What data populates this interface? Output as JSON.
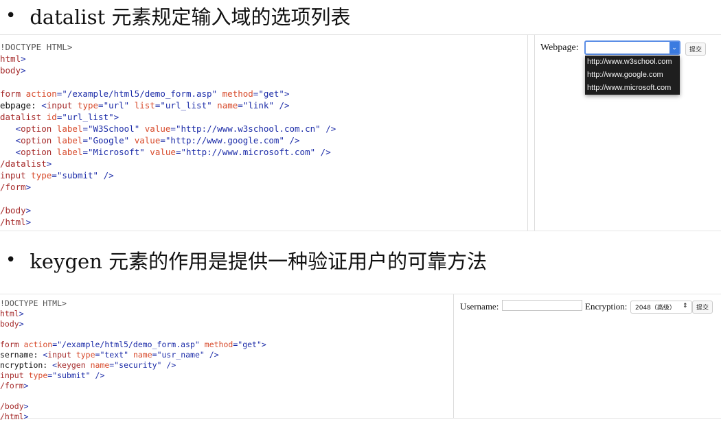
{
  "section1": {
    "bullet": "datalist 元素规定输入域的选项列表",
    "code_lines": [
      "!DOCTYPE HTML>",
      "html>",
      "body>",
      "",
      "form action=\"/example/html5/demo_form.asp\" method=\"get\">",
      "ebpage: <input type=\"url\" list=\"url_list\" name=\"link\" />",
      "datalist id=\"url_list\">",
      "   <option label=\"W3School\" value=\"http://www.w3school.com.cn\" />",
      "   <option label=\"Google\" value=\"http://www.google.com\" />",
      "   <option label=\"Microsoft\" value=\"http://www.microsoft.com\" />",
      "/datalist>",
      "input type=\"submit\" />",
      "/form>",
      "",
      "/body>",
      "/html>"
    ],
    "preview": {
      "label": "Webpage:",
      "input_value": "",
      "submit": "提交",
      "options": [
        "http://www.w3school.com",
        "http://www.google.com",
        "http://www.microsoft.com"
      ]
    }
  },
  "section2": {
    "bullet": "keygen 元素的作用是提供一种验证用户的可靠方法",
    "code_lines": [
      "!DOCTYPE HTML>",
      "html>",
      "body>",
      "",
      "form action=\"/example/html5/demo_form.asp\" method=\"get\">",
      "sername: <input type=\"text\" name=\"usr_name\" />",
      "ncryption: <keygen name=\"security\" />",
      "input type=\"submit\" />",
      "/form>",
      "",
      "/body>",
      "/html>"
    ],
    "preview": {
      "username_label": "Username:",
      "username_value": "",
      "encryption_label": "Encryption:",
      "encryption_value": "2048（高级）",
      "submit": "提交"
    }
  }
}
